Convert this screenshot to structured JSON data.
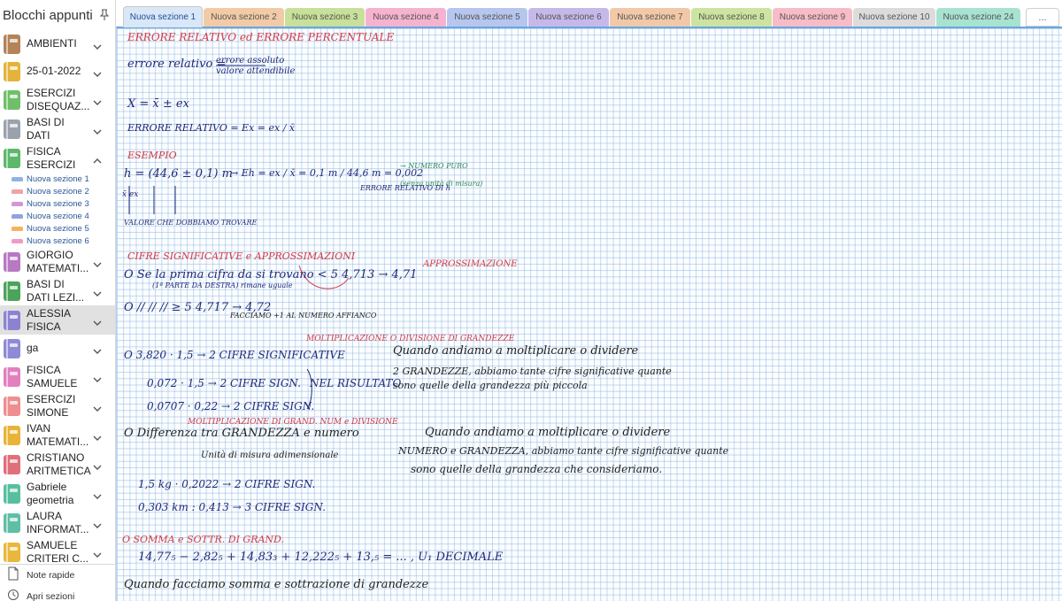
{
  "sidebar": {
    "title": "Blocchi appunti",
    "notebooks": [
      {
        "lines": [
          "AMBIENTI"
        ],
        "color": "#b5835a",
        "chevron": "down"
      },
      {
        "lines": [
          "25-01-2022"
        ],
        "color": "#e3b33a",
        "chevron": "down"
      },
      {
        "lines": [
          "ESERCIZI",
          "DISEQUAZ..."
        ],
        "color": "#6fbf6a",
        "chevron": "down"
      },
      {
        "lines": [
          "BASI DI",
          "DATI"
        ],
        "color": "#9aa2ad",
        "chevron": "down"
      },
      {
        "lines": [
          "FISICA",
          "ESERCIZI"
        ],
        "color": "#5cb86a",
        "chevron": "up"
      },
      {
        "lines": [
          "GIORGIO",
          "MATEMATI..."
        ],
        "color": "#b679c2",
        "chevron": "down"
      },
      {
        "lines": [
          "BASI DI",
          "DATI LEZI..."
        ],
        "color": "#4aa45a",
        "chevron": "down"
      },
      {
        "lines": [
          "ALESSIA",
          "FISICA"
        ],
        "color": "#8c83d0",
        "chevron": "down"
      },
      {
        "lines": [
          "ga"
        ],
        "color": "#8f8ad6",
        "chevron": "down"
      },
      {
        "lines": [
          "FISICA",
          "SAMUELE"
        ],
        "color": "#e37fbf",
        "chevron": "down"
      },
      {
        "lines": [
          "ESERCIZI",
          "SIMONE"
        ],
        "color": "#ee8e8e",
        "chevron": "down"
      },
      {
        "lines": [
          "IVAN",
          "MATEMATI..."
        ],
        "color": "#e8b437",
        "chevron": "down"
      },
      {
        "lines": [
          "CRISTIANO",
          "ARITMETICA"
        ],
        "color": "#e06f7a",
        "chevron": "down"
      },
      {
        "lines": [
          "Gabriele",
          "geometria"
        ],
        "color": "#57bfa0",
        "chevron": "down"
      },
      {
        "lines": [
          "LAURA",
          "INFORMAT..."
        ],
        "color": "#5fbfa6",
        "chevron": "down"
      },
      {
        "lines": [
          "SAMUELE",
          "CRITERI C..."
        ],
        "color": "#e8b73c",
        "chevron": "down"
      }
    ],
    "sections": [
      {
        "label": "Nuova sezione 1",
        "color": "#8fb3e6"
      },
      {
        "label": "Nuova sezione 2",
        "color": "#f0a3a3"
      },
      {
        "label": "Nuova sezione 3",
        "color": "#d596d9"
      },
      {
        "label": "Nuova sezione 4",
        "color": "#8fa3e0"
      },
      {
        "label": "Nuova sezione 5",
        "color": "#f5b35c"
      },
      {
        "label": "Nuova sezione 6",
        "color": "#f29ac6"
      }
    ],
    "footer": {
      "quick_notes": "Note rapide",
      "open_sections": "Apri sezioni"
    }
  },
  "tabs": [
    {
      "label": "Nuova sezione 1",
      "color": "#d9e7f7",
      "active": true
    },
    {
      "label": "Nuova sezione 2",
      "color": "#f2cba6"
    },
    {
      "label": "Nuova sezione 3",
      "color": "#c7e09a"
    },
    {
      "label": "Nuova sezione 4",
      "color": "#f5b3cf"
    },
    {
      "label": "Nuova sezione 5",
      "color": "#b6c6ef"
    },
    {
      "label": "Nuova sezione 6",
      "color": "#c6b9ea"
    },
    {
      "label": "Nuova sezione 7",
      "color": "#f2c9a8"
    },
    {
      "label": "Nuova sezione 8",
      "color": "#cde3a0"
    },
    {
      "label": "Nuova sezione 9",
      "color": "#f7bcc7"
    },
    {
      "label": "Nuova sezione 10",
      "color": "#dcdcdc"
    },
    {
      "label": "Nuova sezione 24",
      "color": "#a8e3d2"
    }
  ],
  "tab_more": "...",
  "notes": [
    {
      "text": "ERRORE RELATIVO ed ERRORE PERCENTUALE",
      "c": "red",
      "s": "s12"
    },
    {
      "text": "errore relativo =",
      "c": "blue",
      "s": "s13"
    },
    {
      "text": "errore assoluto",
      "c": "blue",
      "s": "s10"
    },
    {
      "text": "valore attendibile",
      "c": "blue",
      "s": "s10"
    },
    {
      "text": "X = x̄ ± ex",
      "c": "blue",
      "s": "s13"
    },
    {
      "text": "ERRORE RELATIVO = Ex = ex / x̄",
      "c": "blue",
      "s": "s11"
    },
    {
      "text": "ESEMPIO",
      "c": "red",
      "s": "s11"
    },
    {
      "text": "h = (44,6 ± 0,1) m",
      "c": "blue",
      "s": "s13"
    },
    {
      "text": "→  Eh = ex / x̄ = 0,1 m / 44,6 m = 0,002",
      "c": "blue",
      "s": "s11"
    },
    {
      "text": "→ NUMERO PURO",
      "c": "grn",
      "s": "s8"
    },
    {
      "text": "(senza unità di misura)",
      "c": "grn",
      "s": "s8"
    },
    {
      "text": "ERRORE RELATIVO DI h",
      "c": "blue",
      "s": "s8"
    },
    {
      "text": "x̄     ex",
      "c": "blue",
      "s": "s9"
    },
    {
      "text": "VALORE CHE DOBBIAMO TROVARE",
      "c": "blue",
      "s": "s8"
    },
    {
      "text": "CIFRE SIGNIFICATIVE e APPROSSIMAZIONI",
      "c": "red",
      "s": "s11"
    },
    {
      "text": "APPROSSIMAZIONE",
      "c": "red",
      "s": "s10"
    },
    {
      "text": "O  Se la prima cifra da si trovano  < 5   4,713  → 4,71",
      "c": "blue",
      "s": "s13"
    },
    {
      "text": "(1ª PARTE DA DESTRA)   rimane uguale",
      "c": "blue",
      "s": "s8"
    },
    {
      "text": "O  //        //          //          ≥ 5   4,717  → 4,72",
      "c": "blue",
      "s": "s13"
    },
    {
      "text": "FACCIAMO +1 AL NUMERO AFFIANCO",
      "c": "dark",
      "s": "s8"
    },
    {
      "text": "MOLTIPLICAZIONE O DIVISIONE DI GRANDEZZE",
      "c": "red",
      "s": "s9"
    },
    {
      "text": "O  3,820 · 1,5 → 2 CIFRE SIGNIFICATIVE",
      "c": "blue",
      "s": "s12"
    },
    {
      "text": "0,072 · 1,5 → 2 CIFRE SIGN.",
      "c": "blue",
      "s": "s12"
    },
    {
      "text": "0,0707 · 0,22 → 2 CIFRE SIGN.",
      "c": "blue",
      "s": "s12"
    },
    {
      "text": "NEL RISULTATO",
      "c": "blue",
      "s": "s12"
    },
    {
      "text": "Quando andiamo a moltiplicare o dividere",
      "c": "dark",
      "s": "s13"
    },
    {
      "text": "2 GRANDEZZE, abbiamo tante cifre significative quante",
      "c": "dark",
      "s": "s11"
    },
    {
      "text": "sono quelle della grandezza più piccola",
      "c": "dark",
      "s": "s11"
    },
    {
      "text": "MOLTIPLICAZIONE DI GRAND. NUM e DIVISIONE",
      "c": "red",
      "s": "s9"
    },
    {
      "text": "O  Differenza tra GRANDEZZA e numero",
      "c": "dark",
      "s": "s13"
    },
    {
      "text": "Unità di misura     adimensionale",
      "c": "dark",
      "s": "s10"
    },
    {
      "text": "Quando andiamo a moltiplicare o dividere",
      "c": "dark",
      "s": "s13"
    },
    {
      "text": "NUMERO e GRANDEZZA, abbiamo tante cifre significative quante",
      "c": "dark",
      "s": "s11"
    },
    {
      "text": "sono quelle della grandezza che consideriamo.",
      "c": "dark",
      "s": "s12"
    },
    {
      "text": "1,5 kg · 0,2022  → 2 CIFRE SIGN.",
      "c": "blue",
      "s": "s12"
    },
    {
      "text": "0,303 km : 0,413 → 3 CIFRE SIGN.",
      "c": "blue",
      "s": "s12"
    },
    {
      "text": "O    SOMMA e SOTTR. DI GRAND.",
      "c": "red",
      "s": "s11"
    },
    {
      "text": "14,77₅ − 2,82₅ + 14,83₃ + 12,222₅ + 13,₅ = ... , U₁ DECIMALE",
      "c": "blue",
      "s": "s13"
    },
    {
      "text": "Quando facciamo somma e sottrazione di grandezze",
      "c": "dark",
      "s": "s13"
    }
  ]
}
